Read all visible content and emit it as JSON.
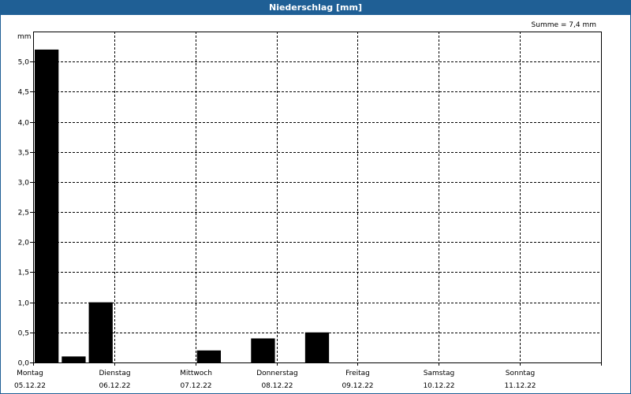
{
  "window": {
    "title": "Niederschlag [mm]"
  },
  "colors": {
    "titlebar": "#1f5f95",
    "bar": "#000000",
    "grid": "#000000"
  },
  "chart_data": {
    "type": "bar",
    "title": "Niederschlag [mm]",
    "annotation": "Summe = 7,4 mm",
    "ylabel": "mm",
    "ylim": [
      0,
      5.5
    ],
    "yticks": [
      0,
      0.5,
      1,
      1.5,
      2,
      2.5,
      3,
      3.5,
      4,
      4.5,
      5
    ],
    "ytick_labels": [
      "0,0",
      "0,5",
      "1,0",
      "1,5",
      "2,0",
      "2,5",
      "3,0",
      "3,5",
      "4,0",
      "4,5",
      "5,0"
    ],
    "grid": true,
    "x_start": "2022-12-05",
    "x_end": "2022-12-12",
    "day_labels": [
      {
        "day": "Montag",
        "date": "05.12.22"
      },
      {
        "day": "Dienstag",
        "date": "06.12.22"
      },
      {
        "day": "Mittwoch",
        "date": "07.12.22"
      },
      {
        "day": "Donnerstag",
        "date": "08.12.22"
      },
      {
        "day": "Freitag",
        "date": "09.12.22"
      },
      {
        "day": "Samstag",
        "date": "10.12.22"
      },
      {
        "day": "Sonntag",
        "date": "11.12.22"
      }
    ],
    "bars": [
      {
        "start": "2022-12-05 00:00",
        "value": 5.2
      },
      {
        "start": "2022-12-05 08:00",
        "value": 0.1
      },
      {
        "start": "2022-12-05 16:00",
        "value": 1.0
      },
      {
        "start": "2022-12-07 00:00",
        "value": 0.2
      },
      {
        "start": "2022-12-07 16:00",
        "value": 0.4
      },
      {
        "start": "2022-12-08 08:00",
        "value": 0.5
      }
    ],
    "bar_duration_hours": 8
  }
}
